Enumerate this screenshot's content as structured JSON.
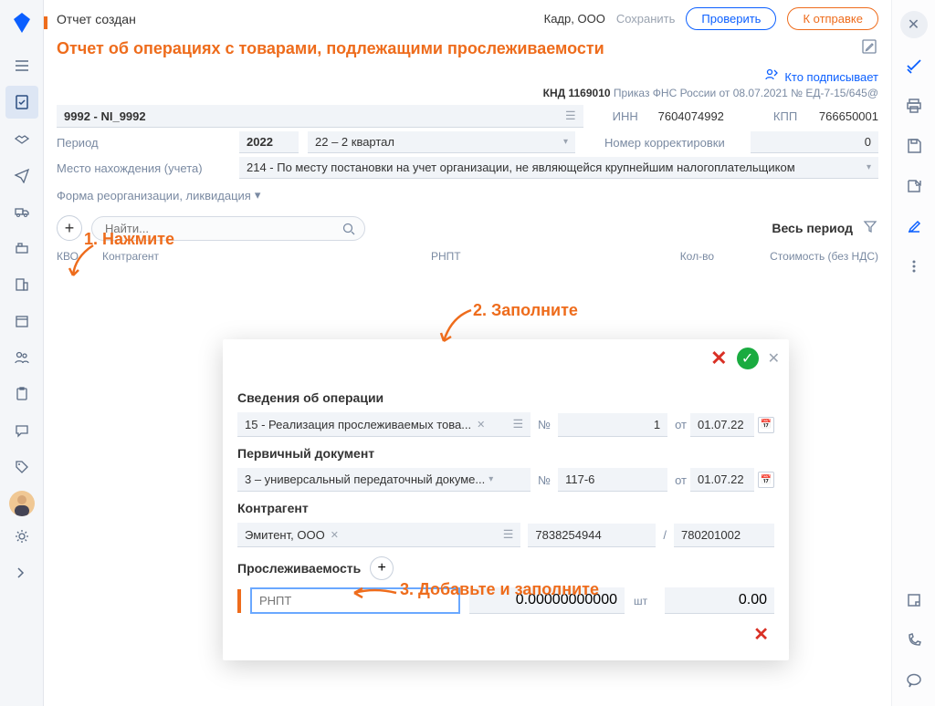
{
  "topbar": {
    "status": "Отчет создан",
    "org": "Кадр, ООО",
    "save": "Сохранить",
    "verify": "Проверить",
    "send": "К отправке"
  },
  "title": "Отчет об операциях с товарами, подлежащими прослеживаемости",
  "signer_link": "Кто подписывает",
  "reg_info": {
    "knd_label": "КНД 1169010",
    "order": "Приказ ФНС России от 08.07.2021 № ЕД-7-15/645@"
  },
  "header_fields": {
    "code": "9992 - NI_9992",
    "inn_label": "ИНН",
    "inn": "7604074992",
    "kpp_label": "КПП",
    "kpp": "766650001",
    "period_label": "Период",
    "year": "2022",
    "quarter": "22 – 2 квартал",
    "corr_label": "Номер корректировки",
    "corr": "0",
    "loc_label": "Место нахождения (учета)",
    "loc": "214 - По месту постановки на учет организации, не являющейся крупнейшим налогоплательщиком",
    "reorg": "Форма реорганизации, ликвидация"
  },
  "toolbar": {
    "search_placeholder": "Найти...",
    "period_link": "Весь период"
  },
  "table_headers": {
    "c1": "КВО",
    "c2": "Контрагент",
    "c3": "РНПТ",
    "c4": "Кол-во",
    "c5": "Стоимость (без НДС)"
  },
  "annotations": {
    "a1": "1. Нажмите",
    "a2": "2. Заполните",
    "a3": "3. Добавьте и заполните"
  },
  "popup": {
    "sec1": "Сведения об операции",
    "op_type": "15 - Реализация прослеживаемых това...",
    "num_label": "№",
    "num1": "1",
    "from_label": "от",
    "date1": "01.07.22",
    "sec2": "Первичный документ",
    "doc_type": "3 – универсальный передаточный докуме...",
    "doc_num": "117-6",
    "date2": "01.07.22",
    "sec3": "Контрагент",
    "contractor": "Эмитент, ООО",
    "ctr_inn": "7838254944",
    "ctr_kpp": "780201002",
    "sec4": "Прослеживаемость",
    "rnpt_placeholder": "РНПТ",
    "qty": "0.00000000000",
    "unit": "шт",
    "cost": "0.00"
  }
}
